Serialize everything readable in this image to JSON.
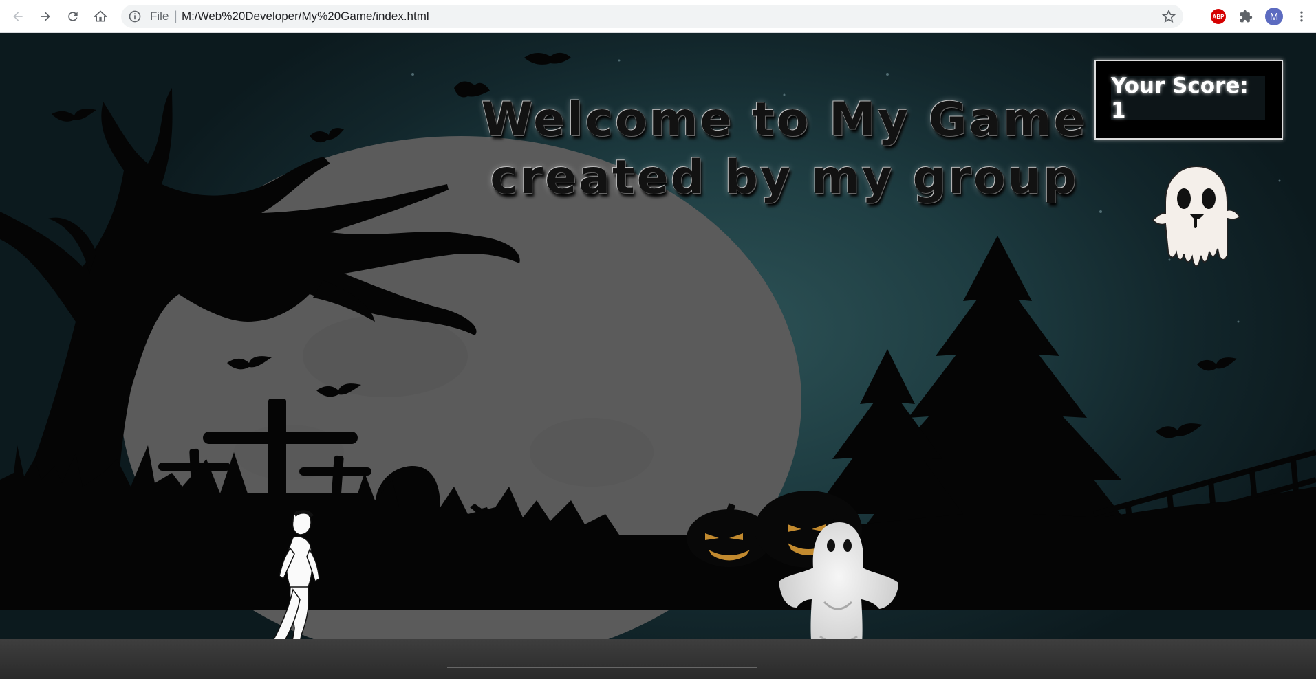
{
  "browser": {
    "omnibox_scheme": "File",
    "omnibox_separator": "|",
    "url": "M:/Web%20Developer/My%20Game/index.html",
    "extensions": {
      "adblock_label": "ABP",
      "profile_initial": "M"
    },
    "icons": [
      "back-arrow-icon",
      "forward-arrow-icon",
      "reload-icon",
      "home-icon",
      "info-icon",
      "bookmark-star-icon",
      "adblock-icon",
      "extensions-puzzle-icon",
      "profile-avatar-icon",
      "menu-dots-icon"
    ]
  },
  "game": {
    "title_line1": "Welcome to My Game",
    "title_line2": "created by my group",
    "score_text": "Your Score: 1",
    "sprites": [
      "player-runner",
      "enemy-ghost",
      "floating-cartoon-ghost",
      "jack-o-lantern",
      "dead-tree",
      "pine-tree",
      "graveyard-crosses",
      "bats",
      "full-moon",
      "fence"
    ],
    "colors": {
      "sky": "#1d3b40",
      "moon": "#5b5b5b",
      "score_bg": "#000000",
      "pumpkin_glow": "#c28a2f"
    }
  }
}
